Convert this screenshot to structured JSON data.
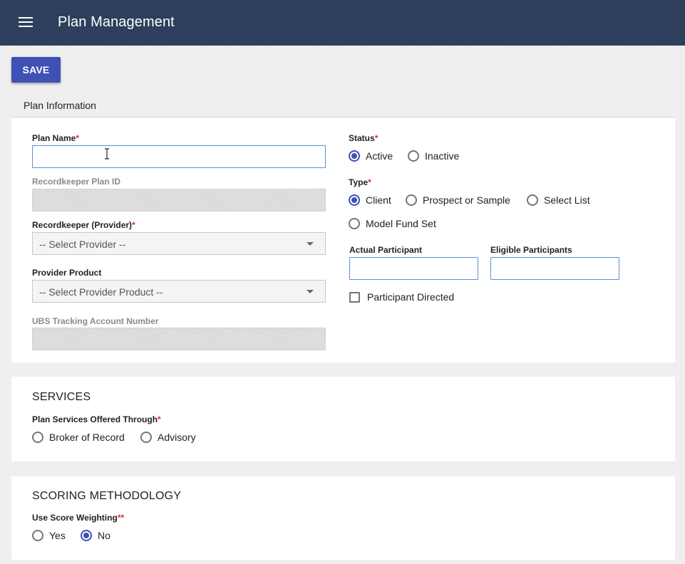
{
  "header": {
    "title": "Plan Management",
    "menu_icon": "hamburger-menu-icon"
  },
  "toolbar": {
    "save_label": "SAVE"
  },
  "tabs": [
    {
      "label": "Plan Information",
      "active": true
    }
  ],
  "plan_info": {
    "plan_name": {
      "label": "Plan Name",
      "required": "*",
      "value": ""
    },
    "recordkeeper_plan_id": {
      "label": "Recordkeeper Plan ID",
      "value": ""
    },
    "recordkeeper_provider": {
      "label": "Recordkeeper (Provider)",
      "required": "*",
      "selected": "-- Select Provider --"
    },
    "provider_product": {
      "label": "Provider Product",
      "selected": "-- Select Provider Product --"
    },
    "ubs_tracking": {
      "label": "UBS Tracking Account Number",
      "value": ""
    },
    "status": {
      "label": "Status",
      "required": "*",
      "options": [
        "Active",
        "Inactive"
      ],
      "selected": "Active"
    },
    "type": {
      "label": "Type",
      "required": "*",
      "options": [
        "Client",
        "Prospect or Sample",
        "Select List",
        "Model Fund Set"
      ],
      "selected": "Client"
    },
    "actual_participant": {
      "label": "Actual Participant",
      "value": ""
    },
    "eligible_participants": {
      "label": "Eligible Participants",
      "value": ""
    },
    "participant_directed": {
      "label": "Participant Directed",
      "checked": false
    }
  },
  "services": {
    "title": "SERVICES",
    "offered_through": {
      "label": "Plan Services Offered Through",
      "required": "*",
      "options": [
        "Broker of Record",
        "Advisory"
      ],
      "selected": null
    }
  },
  "scoring": {
    "title": "SCORING METHODOLOGY",
    "use_score_weighting": {
      "label": "Use Score Weighting",
      "required": "**",
      "options": [
        "Yes",
        "No"
      ],
      "selected": "No"
    }
  },
  "colors": {
    "appbar": "#2c3e5c",
    "primary": "#3f51b5",
    "required": "#d32f2f"
  }
}
